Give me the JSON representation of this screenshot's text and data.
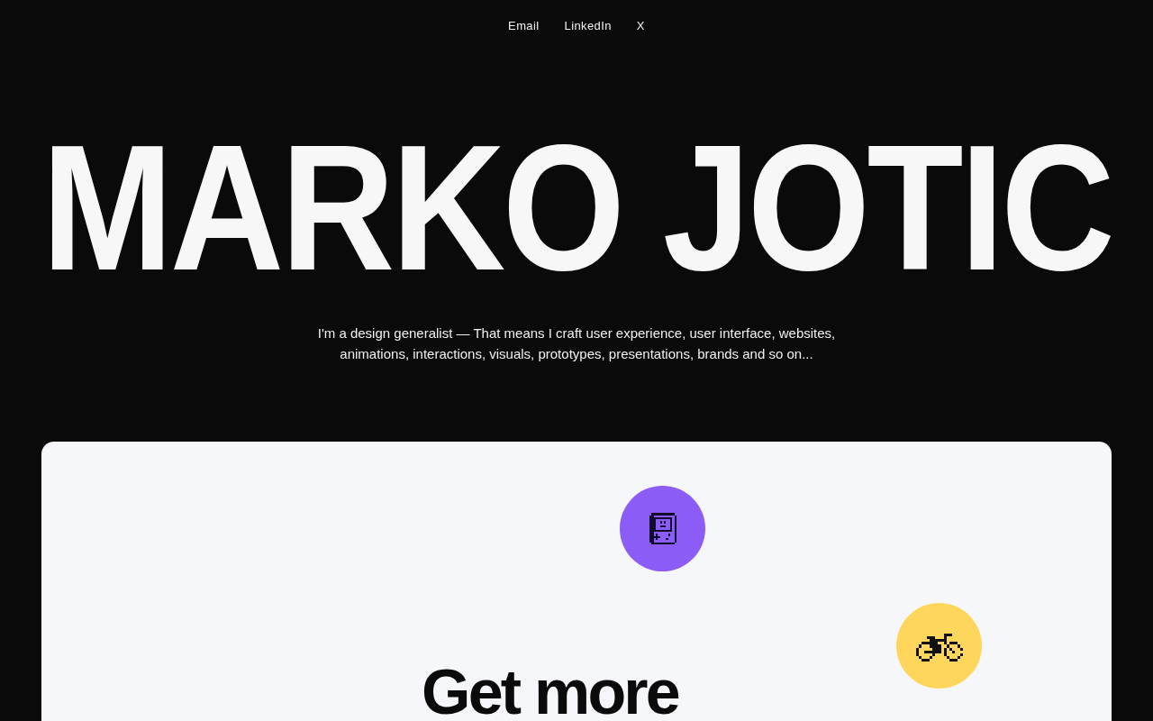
{
  "nav": {
    "links": [
      "Email",
      "LinkedIn",
      "X"
    ]
  },
  "hero": {
    "title": "MARKO JOTIC",
    "intro": "I'm a design generalist — That means I craft user experience, user interface, websites, animations, interactions, visuals, prototypes, presentations, brands and so on..."
  },
  "card": {
    "badges": [
      {
        "kind": "gameboy",
        "color": "#8b5cf6"
      },
      {
        "kind": "bicycle",
        "color": "#ffd65c"
      }
    ],
    "heading": "Get more"
  }
}
